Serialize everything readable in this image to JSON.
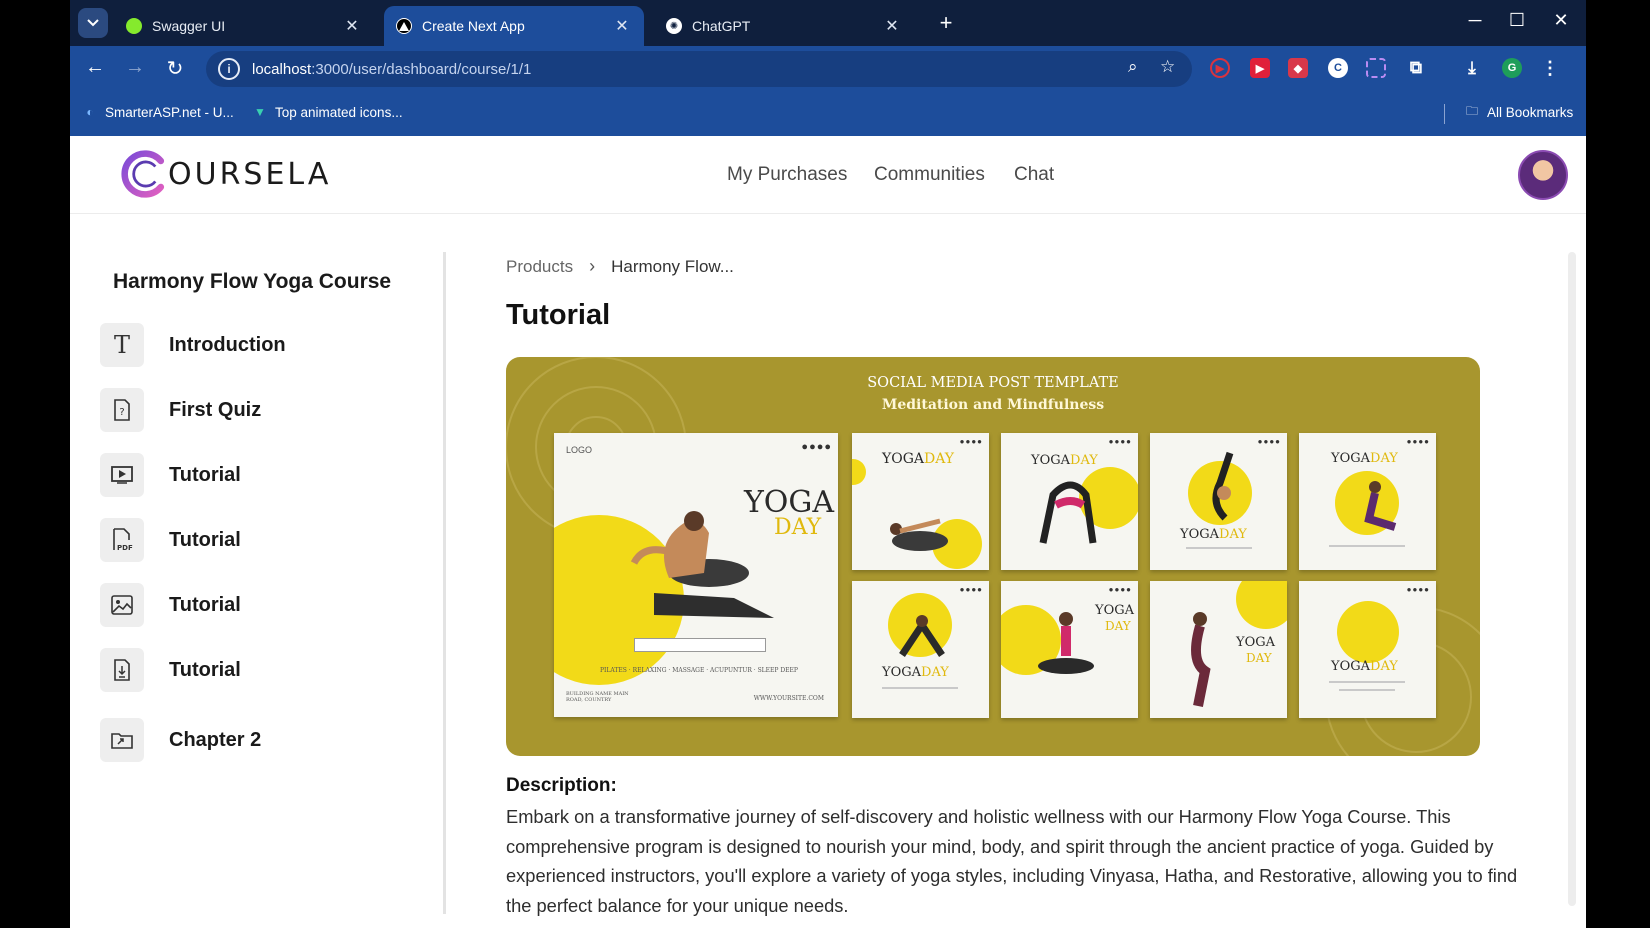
{
  "browser": {
    "tabs": [
      {
        "title": "Swagger UI",
        "active": false,
        "icon": "swagger-icon",
        "color": "#85ea2d"
      },
      {
        "title": "Create Next App",
        "active": true,
        "icon": "nextjs-icon",
        "color": "#000000"
      },
      {
        "title": "ChatGPT",
        "active": false,
        "icon": "chatgpt-icon",
        "color": "#ffffff"
      }
    ],
    "url_host": "localhost",
    "url_path": ":3000/user/dashboard/course/1/1",
    "bookmarks": [
      {
        "label": "SmarterASP.net - U...",
        "icon": "smarterasp-icon"
      },
      {
        "label": "Top animated icons...",
        "icon": "vue-icon"
      }
    ],
    "all_bookmarks": "All Bookmarks",
    "profile_initial": "G"
  },
  "app": {
    "logo_text": "OURSELA",
    "nav": [
      "My Purchases",
      "Communities",
      "Chat"
    ]
  },
  "sidebar": {
    "course_title": "Harmony Flow Yoga Course",
    "items": [
      {
        "label": "Introduction",
        "icon": "text-icon"
      },
      {
        "label": "First Quiz",
        "icon": "quiz-icon"
      },
      {
        "label": "Tutorial",
        "icon": "video-icon"
      },
      {
        "label": "Tutorial",
        "icon": "pdf-icon"
      },
      {
        "label": "Tutorial",
        "icon": "image-icon"
      },
      {
        "label": "Tutorial",
        "icon": "download-file-icon"
      },
      {
        "label": "Chapter 2",
        "icon": "folder-icon"
      }
    ]
  },
  "main": {
    "breadcrumb": [
      "Products",
      "Harmony Flow..."
    ],
    "title": "Tutorial",
    "banner": {
      "heading": "SOCIAL MEDIA POST TEMPLATE",
      "subheading": "Meditation and Mindfulness",
      "big_post": {
        "logo": "LOGO",
        "yoga": "YOGA",
        "day": "DAY",
        "footer": "PILATES · RELAXING · MASSAGE · ACUPUNTUR · SLEEP DEEP",
        "site": "WWW.YOURSITE.COM",
        "address": "BUILDING NAME MAIN ROAD, COUNTRY"
      },
      "small_yoga": "YOGA",
      "small_day": "DAY"
    },
    "description_label": "Description:",
    "description": "Embark on a transformative journey of self-discovery and holistic wellness with our Harmony Flow Yoga Course. This comprehensive program is designed to nourish your mind, body, and spirit through the ancient practice of yoga. Guided by experienced instructors, you'll explore a variety of yoga styles, including Vinyasa, Hatha, and Restorative, allowing you to find the perfect balance for your unique needs."
  }
}
